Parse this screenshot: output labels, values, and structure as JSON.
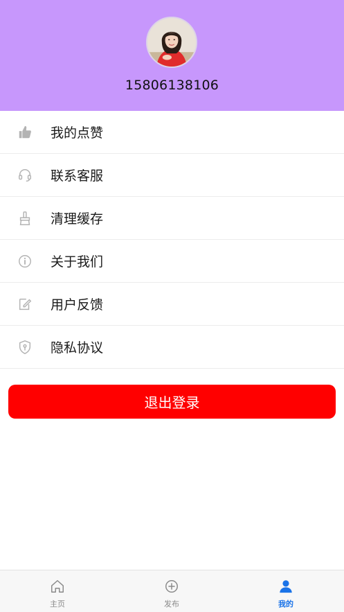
{
  "profile": {
    "phone": "15806138106",
    "avatar_icon": "user-avatar-photo"
  },
  "menu": {
    "items": [
      {
        "label": "我的点赞",
        "icon": "thumbs-up-icon"
      },
      {
        "label": "联系客服",
        "icon": "headset-icon"
      },
      {
        "label": "清理缓存",
        "icon": "broom-icon"
      },
      {
        "label": "关于我们",
        "icon": "info-icon"
      },
      {
        "label": "用户反馈",
        "icon": "edit-feedback-icon"
      },
      {
        "label": "隐私协议",
        "icon": "shield-icon"
      }
    ]
  },
  "actions": {
    "logout_label": "退出登录"
  },
  "tabbar": {
    "tabs": [
      {
        "label": "主页",
        "icon": "home-icon",
        "active": false
      },
      {
        "label": "发布",
        "icon": "plus-circle-icon",
        "active": false
      },
      {
        "label": "我的",
        "icon": "person-icon",
        "active": true
      }
    ]
  },
  "colors": {
    "header_bg": "#c797fc",
    "logout_bg": "#ff0000",
    "tab_active": "#1a73e8",
    "tab_inactive": "#8a8a8a"
  }
}
